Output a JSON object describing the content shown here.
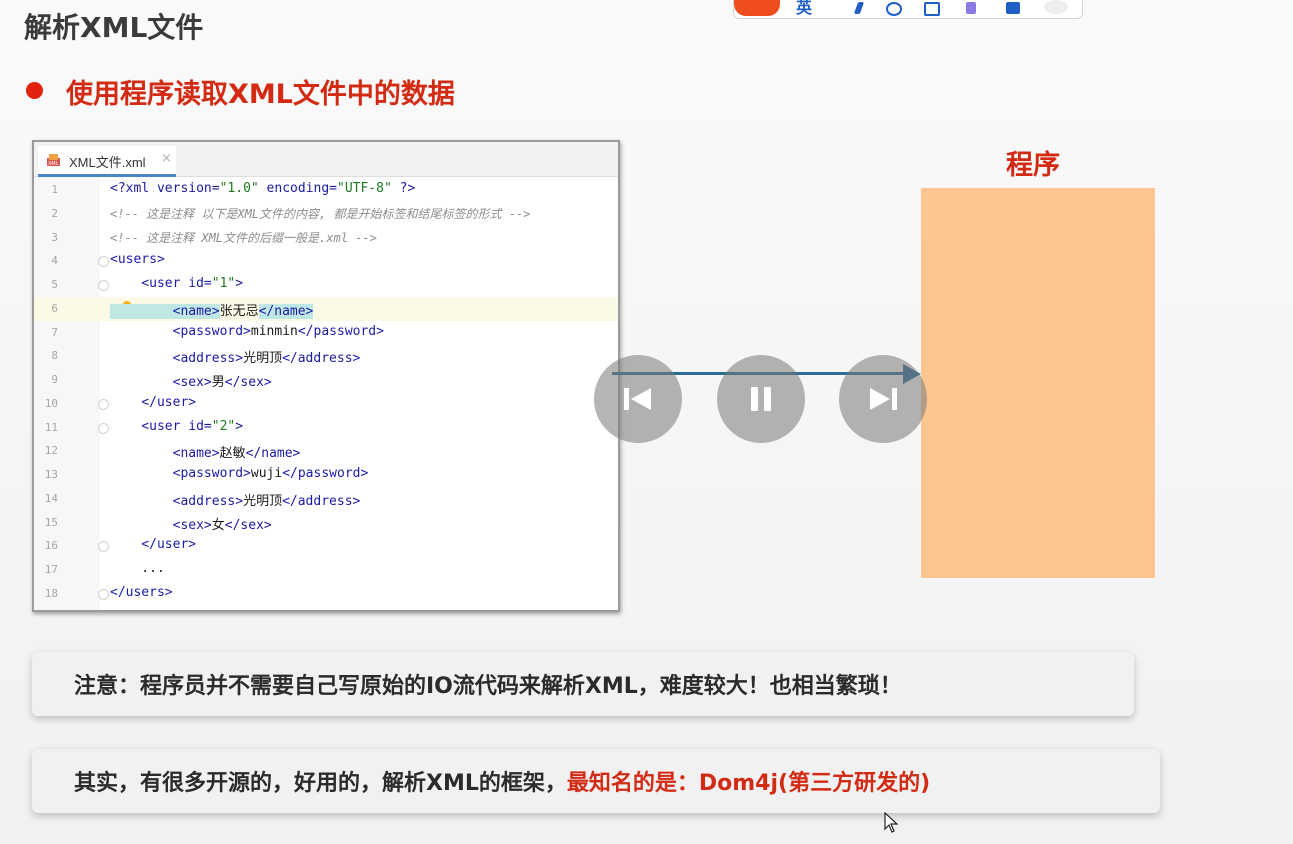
{
  "title": "解析XML文件",
  "bullet": "使用程序读取XML文件中的数据",
  "editor": {
    "tab_label": "XML文件.xml",
    "tab_close": "×",
    "lines": [
      {
        "n": "1",
        "parts": [
          [
            "t",
            "<?xml "
          ],
          [
            "a",
            "version="
          ],
          [
            "v",
            "\"1.0\""
          ],
          [
            "a",
            " encoding="
          ],
          [
            "v",
            "\"UTF-8\""
          ],
          [
            "t",
            " ?>"
          ]
        ]
      },
      {
        "n": "2",
        "parts": [
          [
            "c",
            "<!-- 这是注释 以下是XML文件的内容, 都是开始标签和结尾标签的形式 -->"
          ]
        ]
      },
      {
        "n": "3",
        "parts": [
          [
            "c",
            "<!-- 这是注释 XML文件的后缀一般是.xml -->"
          ]
        ]
      },
      {
        "n": "4",
        "parts": [
          [
            "t",
            "<users>"
          ]
        ]
      },
      {
        "n": "5",
        "parts": [
          [
            "t",
            "    <user "
          ],
          [
            "a",
            "id="
          ],
          [
            "v",
            "\"1\""
          ],
          [
            "t",
            ">"
          ]
        ]
      },
      {
        "n": "6",
        "parts": [
          [
            "s",
            "        <name>"
          ],
          [
            "x",
            "张无忌"
          ],
          [
            "s",
            "</name>"
          ]
        ]
      },
      {
        "n": "7",
        "parts": [
          [
            "t",
            "        <password>"
          ],
          [
            "x",
            "minmin"
          ],
          [
            "t",
            "</password>"
          ]
        ]
      },
      {
        "n": "8",
        "parts": [
          [
            "t",
            "        <address>"
          ],
          [
            "x",
            "光明顶"
          ],
          [
            "t",
            "</address>"
          ]
        ]
      },
      {
        "n": "9",
        "parts": [
          [
            "t",
            "        <sex>"
          ],
          [
            "x",
            "男"
          ],
          [
            "t",
            "</sex>"
          ]
        ]
      },
      {
        "n": "10",
        "parts": [
          [
            "t",
            "    </user>"
          ]
        ]
      },
      {
        "n": "11",
        "parts": [
          [
            "t",
            "    <user "
          ],
          [
            "a",
            "id="
          ],
          [
            "v",
            "\"2\""
          ],
          [
            "t",
            ">"
          ]
        ]
      },
      {
        "n": "12",
        "parts": [
          [
            "t",
            "        <name>"
          ],
          [
            "x",
            "赵敏"
          ],
          [
            "t",
            "</name>"
          ]
        ]
      },
      {
        "n": "13",
        "parts": [
          [
            "t",
            "        <password>"
          ],
          [
            "x",
            "wuji"
          ],
          [
            "t",
            "</password>"
          ]
        ]
      },
      {
        "n": "14",
        "parts": [
          [
            "t",
            "        <address>"
          ],
          [
            "x",
            "光明顶"
          ],
          [
            "t",
            "</address>"
          ]
        ]
      },
      {
        "n": "15",
        "parts": [
          [
            "t",
            "        <sex>"
          ],
          [
            "x",
            "女"
          ],
          [
            "t",
            "</sex>"
          ]
        ]
      },
      {
        "n": "16",
        "parts": [
          [
            "t",
            "    </user>"
          ]
        ]
      },
      {
        "n": "17",
        "parts": [
          [
            "x",
            "    ..."
          ]
        ]
      },
      {
        "n": "18",
        "parts": [
          [
            "t",
            "</users>"
          ]
        ]
      }
    ]
  },
  "program_label": "程序",
  "note1": "注意：程序员并不需要自己写原始的IO流代码来解析XML，难度较大！也相当繁琐！",
  "note2_black": "其实，有很多开源的，好用的，解析XML的框架，",
  "note2_red": "最知名的是：Dom4j(第三方研发的)",
  "topbar_char": "英",
  "colors": {
    "accent_red": "#d32a14",
    "program_box": "#fdc690",
    "arrow": "#2c6d96"
  },
  "media_controls": [
    "previous-icon",
    "pause-icon",
    "next-icon"
  ]
}
